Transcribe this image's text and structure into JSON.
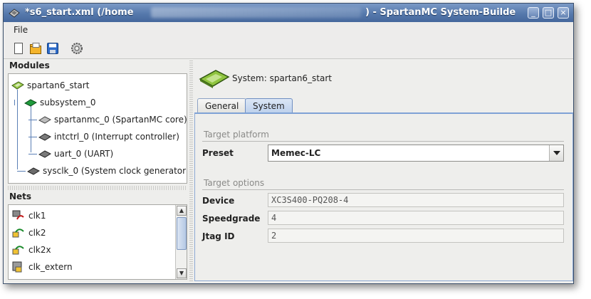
{
  "window": {
    "title_left": "*s6_start.xml (/home",
    "title_right": ") - SpartanMC System-Builde",
    "buttons": {
      "minimize": "_",
      "maximize": "□",
      "close": "×"
    }
  },
  "menu": {
    "file": "File"
  },
  "toolbar": {
    "icons": [
      "new-file-icon",
      "open-folder-icon",
      "save-icon",
      "settings-gear-icon"
    ]
  },
  "modules": {
    "label": "Modules",
    "root": "spartan6_start",
    "subsystem": "subsystem_0",
    "children": [
      "spartanmc_0 (SpartanMC core)",
      "intctrl_0 (Interrupt controller)",
      "uart_0 (UART)"
    ],
    "sysclk": "sysclk_0 (System clock generator)"
  },
  "nets": {
    "label": "Nets",
    "items": [
      "clk1",
      "clk2",
      "clk2x",
      "clk_extern"
    ]
  },
  "system": {
    "title": "System: spartan6_start",
    "tabs": [
      "General",
      "System"
    ],
    "active_tab": "System",
    "target_platform": {
      "section": "Target platform",
      "preset_label": "Preset",
      "preset_value": "Memec-LC"
    },
    "target_options": {
      "section": "Target options",
      "device_label": "Device",
      "device_value": "XC3S400-PQ208-4",
      "speedgrade_label": "Speedgrade",
      "speedgrade_value": "4",
      "jtag_label": "Jtag ID",
      "jtag_value": "2"
    }
  }
}
